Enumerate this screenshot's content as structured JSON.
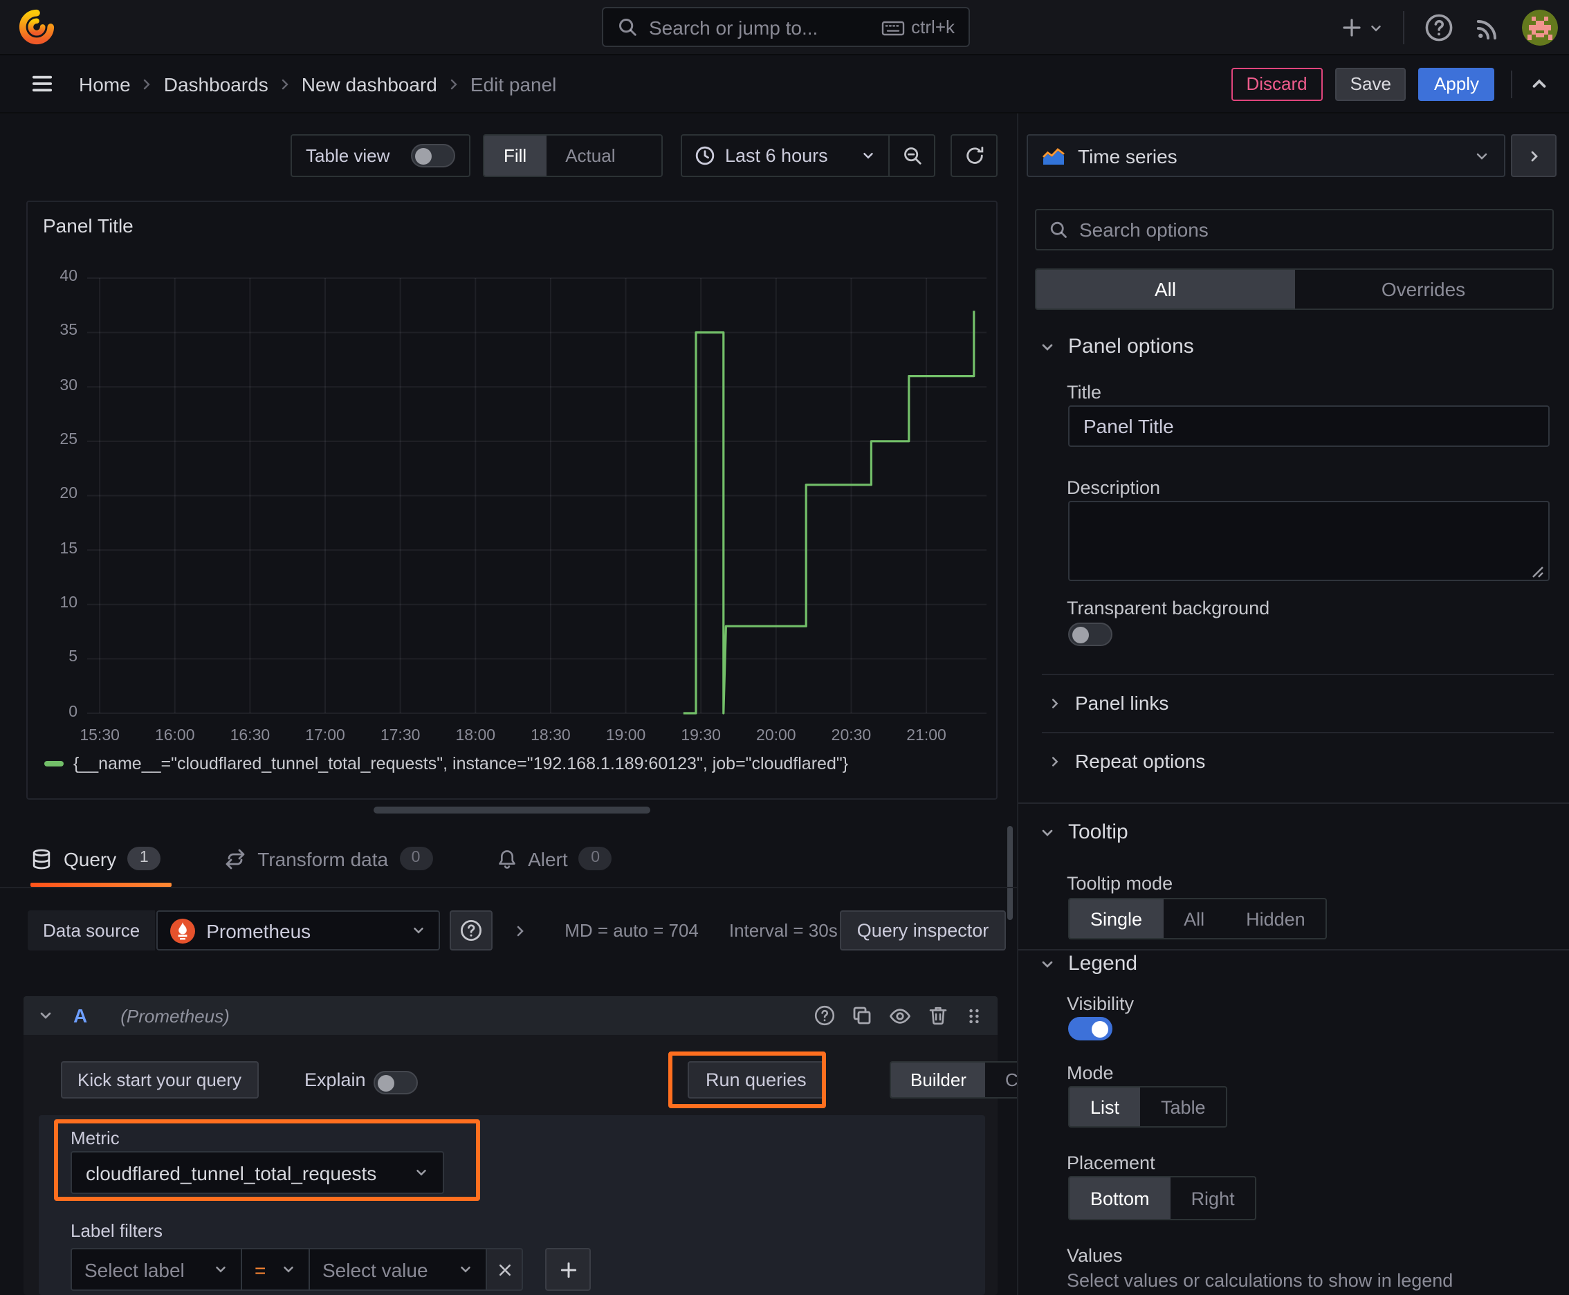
{
  "topbar": {
    "search_placeholder": "Search or jump to...",
    "shortcut": "ctrl+k"
  },
  "breadcrumb": {
    "items": [
      "Home",
      "Dashboards",
      "New dashboard",
      "Edit panel"
    ]
  },
  "actions": {
    "discard": "Discard",
    "save": "Save",
    "apply": "Apply"
  },
  "toolbar": {
    "table_view": "Table view",
    "fill": "Fill",
    "actual": "Actual",
    "time_range": "Last 6 hours"
  },
  "panel": {
    "title": "Panel Title",
    "legend": "{__name__=\"cloudflared_tunnel_total_requests\", instance=\"192.168.1.189:60123\", job=\"cloudflared\"}"
  },
  "chart_data": {
    "type": "line",
    "line_style": "step",
    "title": "Panel Title",
    "xlabel": "",
    "ylabel": "",
    "ylim": [
      0,
      40
    ],
    "y_ticks": [
      0,
      5,
      10,
      15,
      20,
      25,
      30,
      35,
      40
    ],
    "x_ticks": [
      "15:30",
      "16:00",
      "16:30",
      "17:00",
      "17:30",
      "18:00",
      "18:30",
      "19:00",
      "19:30",
      "20:00",
      "20:30",
      "21:00"
    ],
    "x_domain": [
      "15:25",
      "21:24"
    ],
    "grid": true,
    "legend_position": "bottom",
    "series": [
      {
        "name": "{__name__=\"cloudflared_tunnel_total_requests\", instance=\"192.168.1.189:60123\", job=\"cloudflared\"}",
        "color": "#73bf69",
        "points": [
          [
            "19:23",
            0
          ],
          [
            "19:28",
            0
          ],
          [
            "19:28",
            35
          ],
          [
            "19:39",
            35
          ],
          [
            "19:39",
            0
          ],
          [
            "19:40",
            8
          ],
          [
            "20:12",
            8
          ],
          [
            "20:12",
            21
          ],
          [
            "20:38",
            21
          ],
          [
            "20:38",
            25
          ],
          [
            "20:53",
            25
          ],
          [
            "20:53",
            31
          ],
          [
            "21:19",
            31
          ],
          [
            "21:19",
            37
          ]
        ]
      }
    ]
  },
  "query_tabs": {
    "query": "Query",
    "query_count": "1",
    "transform": "Transform data",
    "transform_count": "0",
    "alert": "Alert",
    "alert_count": "0"
  },
  "datasource_row": {
    "label": "Data source",
    "datasource": "Prometheus",
    "stats_md": "MD = auto = 704",
    "stats_interval": "Interval = 30s",
    "query_inspector": "Query inspector"
  },
  "query_editor": {
    "ref_id": "A",
    "ds_hint": "(Prometheus)",
    "kick_start": "Kick start your query",
    "explain": "Explain",
    "run_queries": "Run queries",
    "builder": "Builder",
    "code": "Code",
    "metric_label": "Metric",
    "metric_value": "cloudflared_tunnel_total_requests",
    "label_filters_label": "Label filters",
    "select_label": "Select label",
    "operator": "=",
    "select_value": "Select value"
  },
  "options_pane": {
    "viz_type": "Time series",
    "search_placeholder": "Search options",
    "tab_all": "All",
    "tab_overrides": "Overrides",
    "panel_options": {
      "heading": "Panel options",
      "title_label": "Title",
      "title_value": "Panel Title",
      "description_label": "Description",
      "transparent_label": "Transparent background"
    },
    "links_heading": "Panel links",
    "repeat_heading": "Repeat options",
    "tooltip": {
      "heading": "Tooltip",
      "mode_label": "Tooltip mode",
      "options": [
        "Single",
        "All",
        "Hidden"
      ],
      "selected": "Single"
    },
    "legend": {
      "heading": "Legend",
      "visibility_label": "Visibility",
      "mode_label": "Mode",
      "mode_options": [
        "List",
        "Table"
      ],
      "mode_selected": "List",
      "placement_label": "Placement",
      "placement_options": [
        "Bottom",
        "Right"
      ],
      "placement_selected": "Bottom",
      "values_label": "Values",
      "values_help": "Select values or calculations to show in legend"
    }
  },
  "colors": {
    "series_green": "#73bf69",
    "primary_blue": "#3d71d9",
    "annotation_orange": "#ff6f1f",
    "tab_underline": "#ff7a1a",
    "discard_pink": "#ee5c8c",
    "prometheus_orange": "#e6522c"
  }
}
